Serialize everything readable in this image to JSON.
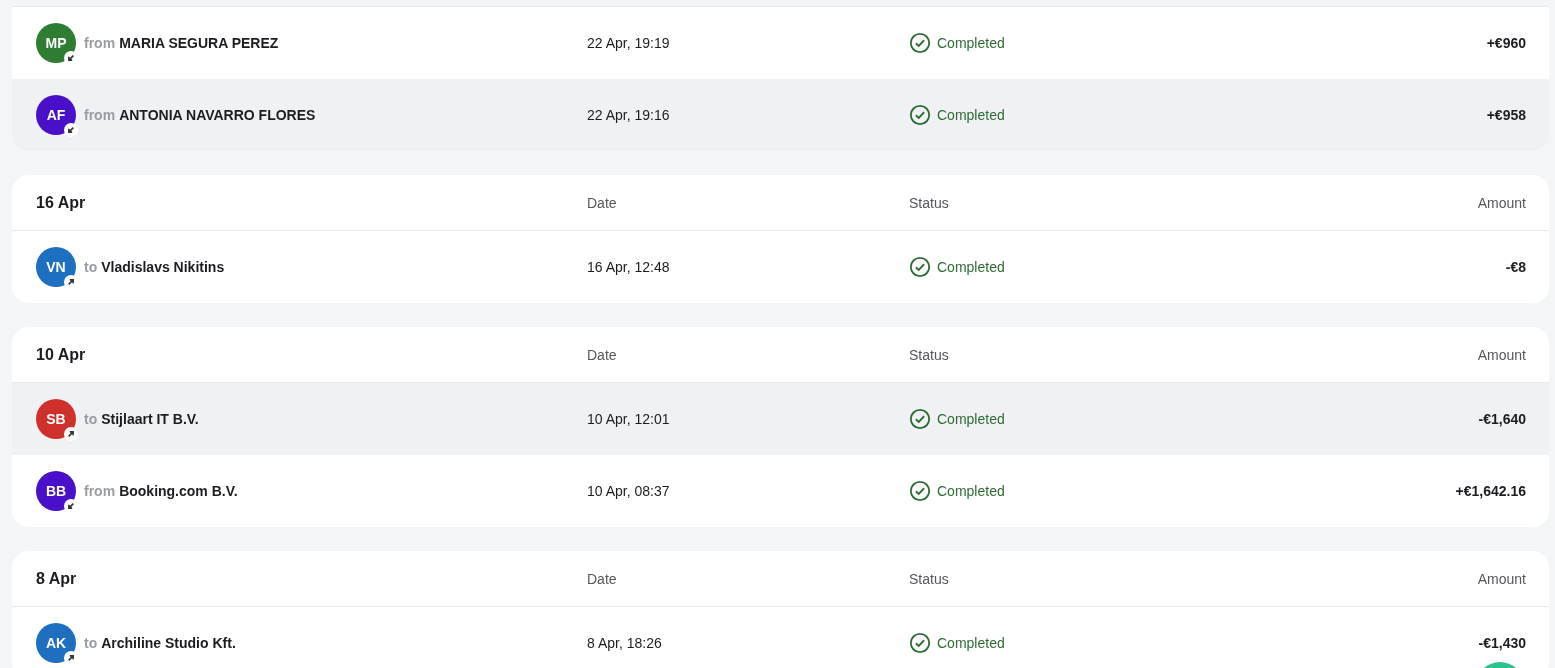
{
  "groups": [
    {
      "rows": [
        {
          "initials": "MP",
          "color": "#2e7d32",
          "kind": "in",
          "direction": "from",
          "name": "MARIA SEGURA PEREZ",
          "date": "22 Apr, 19:19",
          "status": "Completed",
          "amount": "+€960",
          "highlighted": false
        },
        {
          "initials": "AF",
          "color": "#4a0fc9",
          "kind": "in",
          "direction": "from",
          "name": "ANTONIA NAVARRO FLORES",
          "date": "22 Apr, 19:16",
          "status": "Completed",
          "amount": "+€958",
          "highlighted": true
        }
      ]
    },
    {
      "title": "16 Apr",
      "columns": [
        "Date",
        "Status",
        "Amount"
      ],
      "rows": [
        {
          "initials": "VN",
          "color": "#1e6fbf",
          "kind": "out",
          "direction": "to",
          "name": "Vladislavs Nikitins",
          "date": "16 Apr, 12:48",
          "status": "Completed",
          "amount": "-€8",
          "highlighted": false
        }
      ]
    },
    {
      "title": "10 Apr",
      "columns": [
        "Date",
        "Status",
        "Amount"
      ],
      "rows": [
        {
          "initials": "SB",
          "color": "#d0302b",
          "kind": "out",
          "direction": "to",
          "name": "Stijlaart IT B.V.",
          "date": "10 Apr, 12:01",
          "status": "Completed",
          "amount": "-€1,640",
          "highlighted": true
        },
        {
          "initials": "BB",
          "color": "#4a0fc9",
          "kind": "in",
          "direction": "from",
          "name": "Booking.com B.V.",
          "date": "10 Apr, 08:37",
          "status": "Completed",
          "amount": "+€1,642.16",
          "highlighted": false
        }
      ]
    },
    {
      "title": "8 Apr",
      "columns": [
        "Date",
        "Status",
        "Amount"
      ],
      "rows": [
        {
          "initials": "AK",
          "color": "#1e6fbf",
          "kind": "out",
          "direction": "to",
          "name": "Archiline Studio Kft.",
          "date": "8 Apr, 18:26",
          "status": "Completed",
          "amount": "-€1,430",
          "highlighted": false
        }
      ]
    }
  ]
}
